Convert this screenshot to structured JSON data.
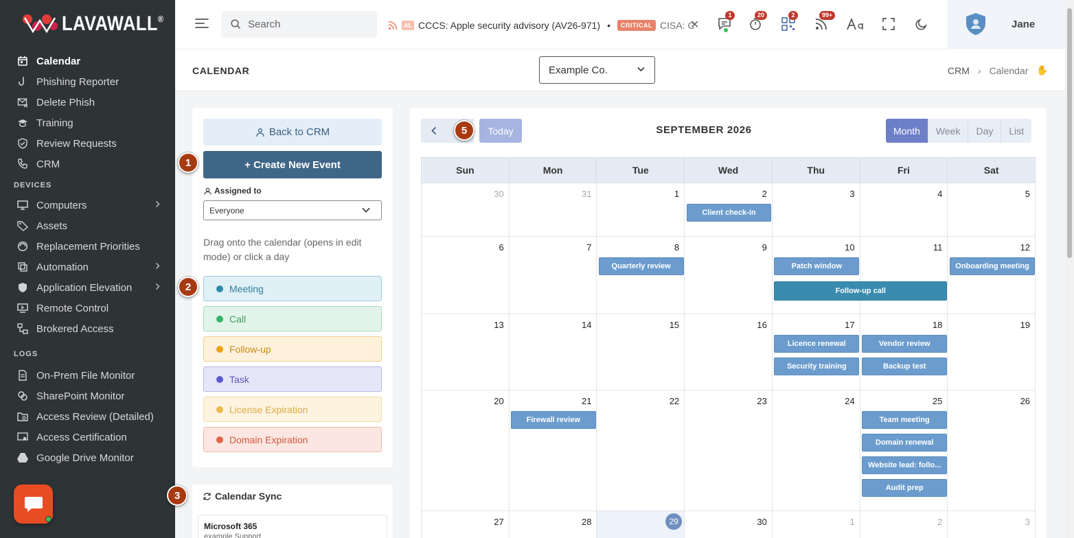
{
  "brand": {
    "name": "LAVAWALL",
    "mark": "®"
  },
  "sidebar": {
    "main": [
      {
        "label": "Calendar",
        "icon": "calendar-icon",
        "active": true
      },
      {
        "label": "Phishing Reporter",
        "icon": "hook-icon"
      },
      {
        "label": "Delete Phish",
        "icon": "mail-x-icon"
      },
      {
        "label": "Training",
        "icon": "graduation-icon"
      },
      {
        "label": "Review Requests",
        "icon": "shield-check-icon"
      },
      {
        "label": "CRM",
        "icon": "phone-icon"
      }
    ],
    "devices_heading": "DEVICES",
    "devices": [
      {
        "label": "Computers",
        "icon": "monitor-icon",
        "expandable": true
      },
      {
        "label": "Assets",
        "icon": "tag-icon"
      },
      {
        "label": "Replacement Priorities",
        "icon": "priority-icon"
      },
      {
        "label": "Automation",
        "icon": "automation-icon",
        "expandable": true
      },
      {
        "label": "Application Elevation",
        "icon": "shield-icon",
        "expandable": true
      },
      {
        "label": "Remote Control",
        "icon": "remote-icon"
      },
      {
        "label": "Brokered Access",
        "icon": "network-icon"
      }
    ],
    "logs_heading": "LOGS",
    "logs": [
      {
        "label": "On-Prem File Monitor",
        "icon": "file-icon"
      },
      {
        "label": "SharePoint Monitor",
        "icon": "sharepoint-icon"
      },
      {
        "label": "Access Review (Detailed)",
        "icon": "folder-search-icon"
      },
      {
        "label": "Access Certification",
        "icon": "certificate-icon"
      },
      {
        "label": "Google Drive Monitor",
        "icon": "drive-icon"
      }
    ]
  },
  "topbar": {
    "search_placeholder": "Search",
    "ticker": {
      "tag1": "AL",
      "text1": "CCCS: Apple security advisory (AV26-971)",
      "bullet": "•",
      "tag2": "CRITICAL",
      "text2": "CISA: C"
    },
    "badges": {
      "messages": "1",
      "timer": "20",
      "qr": "2",
      "feeds": "99+"
    },
    "user_name": "Jane"
  },
  "page": {
    "title": "CALENDAR",
    "company": "Example Co.",
    "breadcrumb": [
      "CRM",
      "Calendar"
    ]
  },
  "panel": {
    "back": "Back to CRM",
    "create": "+ Create New Event",
    "assigned_label": "Assigned to",
    "assigned_value": "Everyone",
    "hint": "Drag onto the calendar (opens in edit mode) or click a day",
    "event_types": [
      {
        "label": "Meeting",
        "bg": "#dff0f7",
        "border": "#9fcde0",
        "dot": "#2f8aa8",
        "text": "#2f7f9c"
      },
      {
        "label": "Call",
        "bg": "#e2f4ea",
        "border": "#a7dbbe",
        "dot": "#3ab36a",
        "text": "#3b9b5e"
      },
      {
        "label": "Follow-up",
        "bg": "#fdf1dc",
        "border": "#f3cf8f",
        "dot": "#e9a21a",
        "text": "#c98b17"
      },
      {
        "label": "Task",
        "bg": "#e6e6f8",
        "border": "#b9b9e6",
        "dot": "#5a5ad0",
        "text": "#5a5ab8"
      },
      {
        "label": "License Expiration",
        "bg": "#fdf3df",
        "border": "#f4d9a6",
        "dot": "#ecbb4c",
        "text": "#dcac45"
      },
      {
        "label": "Domain Expiration",
        "bg": "#fbe6e1",
        "border": "#f1b9ac",
        "dot": "#e06448",
        "text": "#d05a40"
      }
    ],
    "sync_title": "Calendar Sync",
    "sync_provider": "Microsoft 365",
    "sync_account": "example Support"
  },
  "markers": [
    "1",
    "2",
    "3",
    "5"
  ],
  "calendar": {
    "month_title": "SEPTEMBER 2026",
    "today_label": "Today",
    "views": [
      "Month",
      "Week",
      "Day",
      "List"
    ],
    "active_view": "Month",
    "weekdays": [
      "Sun",
      "Mon",
      "Tue",
      "Wed",
      "Thu",
      "Fri",
      "Sat"
    ],
    "weeks": [
      [
        "30",
        "31",
        "1",
        "2",
        "3",
        "4",
        "5"
      ],
      [
        "6",
        "7",
        "8",
        "9",
        "10",
        "11",
        "12"
      ],
      [
        "13",
        "14",
        "15",
        "16",
        "17",
        "18",
        "19"
      ],
      [
        "20",
        "21",
        "22",
        "23",
        "24",
        "25",
        "26"
      ],
      [
        "27",
        "28",
        "29",
        "30",
        "1",
        "2",
        "3"
      ]
    ],
    "events": [
      {
        "title": "Client check-in",
        "week": 0,
        "day": 3,
        "slot": 0,
        "span": 1
      },
      {
        "title": "Quarterly review",
        "week": 1,
        "day": 2,
        "slot": 0,
        "span": 1
      },
      {
        "title": "Patch window",
        "week": 1,
        "day": 4,
        "slot": 0,
        "span": 1
      },
      {
        "title": "Onboarding meeting",
        "week": 1,
        "day": 6,
        "slot": 0,
        "span": 1
      },
      {
        "title": "Follow-up call",
        "week": 1,
        "day": 4,
        "slot": 1,
        "span": 2,
        "style": "dark"
      },
      {
        "title": "Licence renewal",
        "week": 2,
        "day": 4,
        "slot": 0,
        "span": 1
      },
      {
        "title": "Vendor review",
        "week": 2,
        "day": 5,
        "slot": 0,
        "span": 1
      },
      {
        "title": "Security training",
        "week": 2,
        "day": 4,
        "slot": 1,
        "span": 1
      },
      {
        "title": "Backup test",
        "week": 2,
        "day": 5,
        "slot": 1,
        "span": 1
      },
      {
        "title": "Firewall review",
        "week": 3,
        "day": 1,
        "slot": 0,
        "span": 1
      },
      {
        "title": "Team meeting",
        "week": 3,
        "day": 5,
        "slot": 0,
        "span": 1
      },
      {
        "title": "Domain renewal",
        "week": 3,
        "day": 5,
        "slot": 1,
        "span": 1
      },
      {
        "title": "Website lead: follo...",
        "week": 3,
        "day": 5,
        "slot": 2,
        "span": 1
      },
      {
        "title": "Audit prep",
        "week": 3,
        "day": 5,
        "slot": 3,
        "span": 1
      }
    ]
  }
}
